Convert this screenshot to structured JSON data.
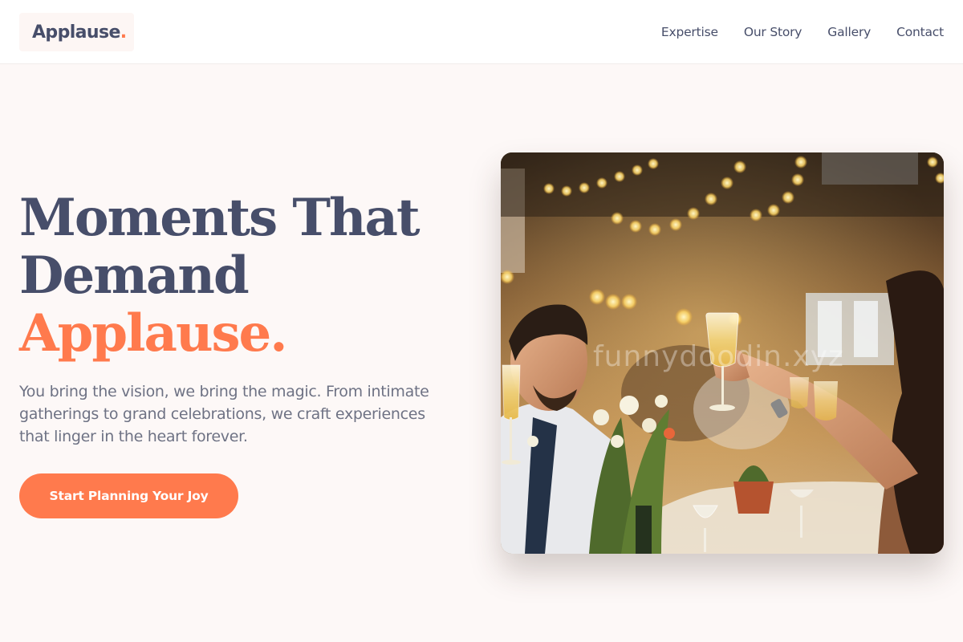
{
  "brand": {
    "name": "Applause",
    "dot": ".",
    "accent_color": "#ff7a4d",
    "text_color": "#474e6a"
  },
  "nav": {
    "items": [
      {
        "label": "Expertise"
      },
      {
        "label": "Our Story"
      },
      {
        "label": "Gallery"
      },
      {
        "label": "Contact"
      }
    ]
  },
  "hero": {
    "title_line1": "Moments That",
    "title_line2": "Demand",
    "title_line3": "Applause.",
    "subtitle": "You bring the vision, we bring the magic. From intimate gatherings to grand celebrations, we craft experiences that linger in the heart forever.",
    "cta_label": "Start Planning Your Joy"
  },
  "image": {
    "alt": "Guests raising champagne glasses at a festive banquet table under string lights",
    "watermark": "funnydoodin.xyz"
  }
}
